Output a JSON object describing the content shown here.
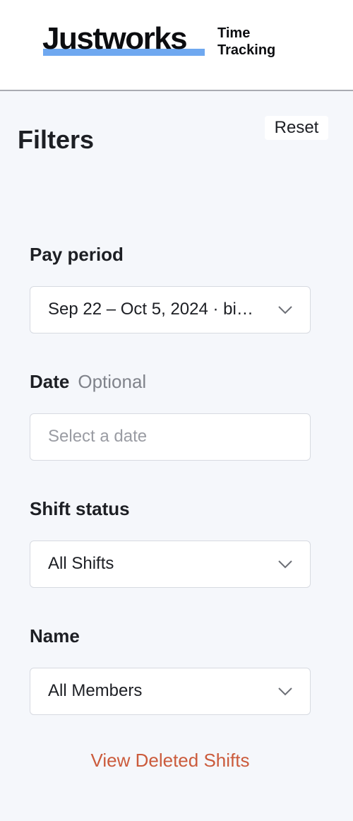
{
  "header": {
    "logo": "Justworks",
    "product_line1": "Time",
    "product_line2": "Tracking",
    "logo_color": "#0c0d10",
    "logo_accent": "#6fa8f0"
  },
  "filters": {
    "title": "Filters",
    "reset_label": "Reset",
    "pay_period": {
      "label": "Pay period",
      "value": "Sep 22 – Oct 5, 2024 · biweekly",
      "icon": "chevron-down-icon"
    },
    "date": {
      "label": "Date",
      "optional_label": "Optional",
      "placeholder": "Select a date"
    },
    "shift_status": {
      "label": "Shift status",
      "value": "All Shifts",
      "icon": "chevron-down-icon"
    },
    "name": {
      "label": "Name",
      "value": "All Members",
      "icon": "chevron-down-icon"
    },
    "deleted_link": "View Deleted Shifts",
    "link_color": "#cb5b3c"
  }
}
